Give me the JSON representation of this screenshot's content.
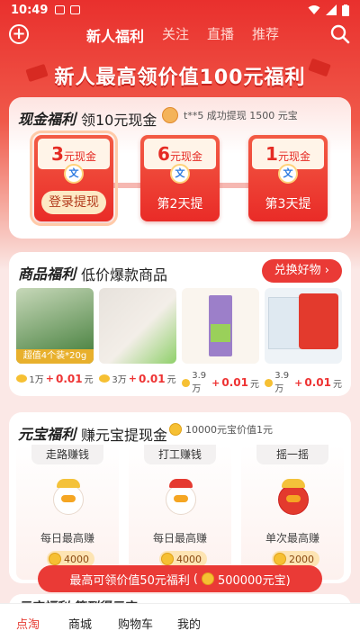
{
  "status": {
    "time": "10:49"
  },
  "nav": {
    "tabs": [
      "新人福利",
      "关注",
      "直播",
      "推荐"
    ],
    "active": 0
  },
  "banner": {
    "title": "新人最高领价值100元福利"
  },
  "cash": {
    "title": "现金福利",
    "subtitle": "领10元现金",
    "ticker": "t**5 成功提现 1500 元宝",
    "items": [
      {
        "amount": "3",
        "unit": "元现金",
        "label": "登录提现",
        "is_button": true
      },
      {
        "amount": "6",
        "unit": "元现金",
        "label": "第2天提",
        "is_button": false
      },
      {
        "amount": "1",
        "unit": "元现金",
        "label": "第3天提",
        "is_button": false
      }
    ],
    "wx_glyph": "文"
  },
  "goods": {
    "title": "商品福利",
    "subtitle": "低价爆款商品",
    "exchange_label": "兑换好物 ›",
    "promo_line1": "超值4个装*20g",
    "products": [
      {
        "coin": "1万",
        "plus": "+",
        "cash": "0.01",
        "unit": "元",
        "colors": [
          "#3e7a35",
          "#c7d8b9"
        ]
      },
      {
        "coin": "3万",
        "plus": "+",
        "cash": "0.01",
        "unit": "元",
        "colors": [
          "#e7e2dc",
          "#8fd06a"
        ]
      },
      {
        "coin": "3.9万",
        "plus": "+",
        "cash": "0.01",
        "unit": "元",
        "colors": [
          "#faf5ee",
          "#9c7fc9"
        ]
      },
      {
        "coin": "3.9万",
        "plus": "+",
        "cash": "0.01",
        "unit": "元",
        "colors": [
          "#eef3f7",
          "#e33a2d"
        ]
      }
    ]
  },
  "yuanbao": {
    "title": "元宝福利",
    "subtitle": "赚元宝提现金",
    "note": "10000元宝价值1元",
    "tasks": [
      {
        "tag": "走路赚钱",
        "desc": "每日最高赚",
        "reward": "4000"
      },
      {
        "tag": "打工赚钱",
        "desc": "每日最高赚",
        "reward": "4000"
      },
      {
        "tag": "摇一摇",
        "desc": "单次最高赚",
        "reward": "2000"
      }
    ],
    "claim_text": "最高可领价值50元福利",
    "claim_sub": "500000元宝)",
    "claim_open": "("
  },
  "peek": {
    "text": "元宝福利 签到得元宝"
  },
  "bottom_nav": [
    "点淘",
    "商城",
    "购物车",
    "我的"
  ]
}
